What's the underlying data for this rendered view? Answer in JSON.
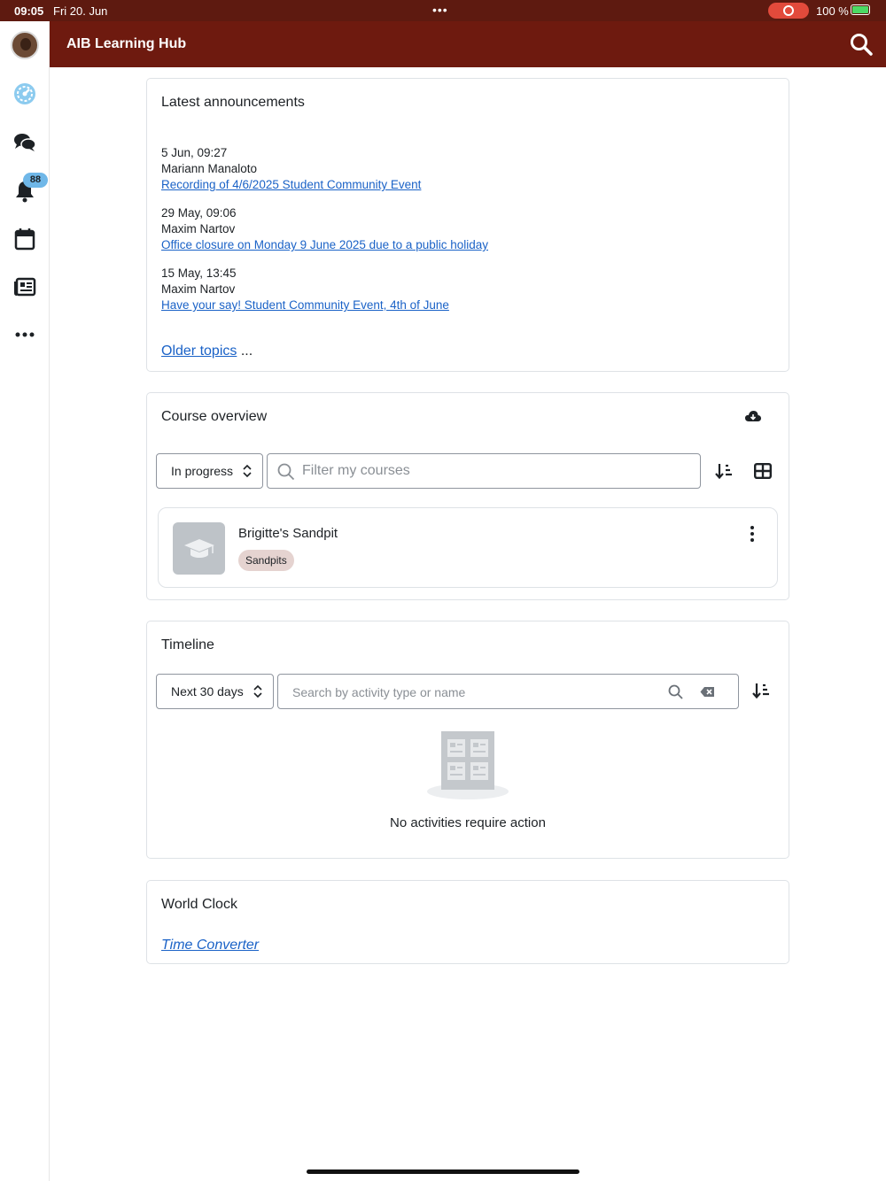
{
  "status_bar": {
    "time": "09:05",
    "date": "Fri 20. Jun",
    "battery": "100 %"
  },
  "app": {
    "title": "AIB Learning Hub"
  },
  "sidebar": {
    "notification_count": "88"
  },
  "announcements": {
    "title": "Latest announcements",
    "items": [
      {
        "date": "5 Jun, 09:27",
        "author": "Mariann Manaloto",
        "link": "Recording of 4/6/2025 Student Community Event"
      },
      {
        "date": "29 May, 09:06",
        "author": "Maxim Nartov",
        "link": "Office closure on Monday 9 June 2025 due to a public holiday"
      },
      {
        "date": "15 May, 13:45",
        "author": "Maxim Nartov",
        "link": "Have your say! Student Community Event, 4th of June"
      }
    ],
    "older_link": "Older topics",
    "older_suffix": " ..."
  },
  "course_overview": {
    "title": "Course overview",
    "filter_select": "In progress",
    "search_placeholder": "Filter my courses",
    "course": {
      "name": "Brigitte's Sandpit",
      "category": "Sandpits"
    }
  },
  "timeline": {
    "title": "Timeline",
    "range_select": "Next 30 days",
    "search_placeholder": "Search by activity type or name",
    "empty_message": "No activities require action"
  },
  "world_clock": {
    "title": "World Clock",
    "link": "Time Converter"
  },
  "colors": {
    "header": "#6e1a0f",
    "statusbar": "#5e1a10",
    "link": "#1a62c7",
    "badge": "#6fb7e8",
    "tag": "#e5d3d0"
  }
}
